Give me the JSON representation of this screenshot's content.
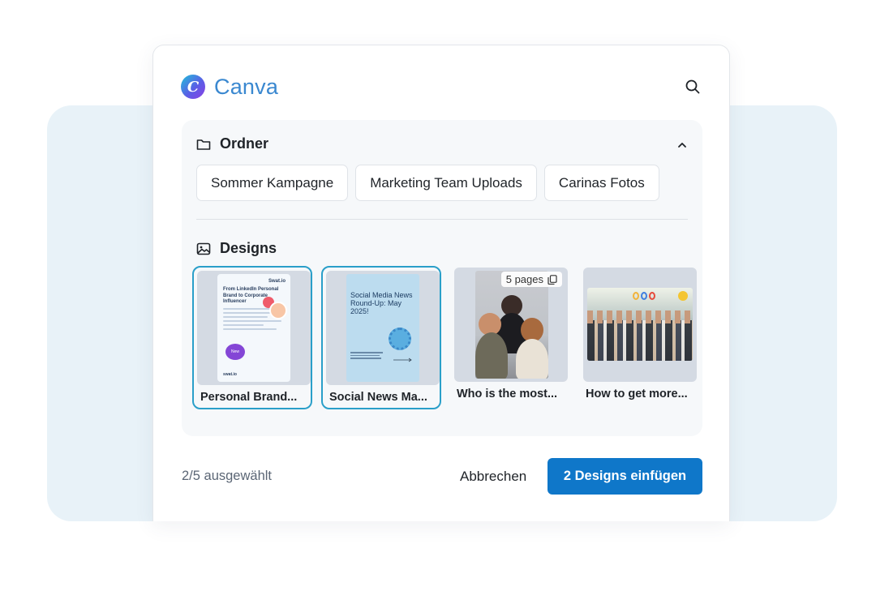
{
  "app": {
    "brand": "Canva",
    "logo_letter": "C"
  },
  "folders": {
    "title": "Ordner",
    "items": [
      {
        "label": "Sommer Kampagne"
      },
      {
        "label": "Marketing Team Uploads"
      },
      {
        "label": "Carinas Fotos"
      }
    ]
  },
  "designs": {
    "title": "Designs",
    "items": [
      {
        "label": "Personal Brand...",
        "selected": true,
        "thumb_text": {
          "logo": "Swat.io",
          "headline": "From LinkedIn Personal Brand to Corporate Influencer",
          "badge": "New",
          "footer": "swat.io"
        }
      },
      {
        "label": "Social News Ma...",
        "selected": true,
        "thumb_text": {
          "headline": "Social Media News Round-Up: May 2025!"
        }
      },
      {
        "label": "Who is the most...",
        "selected": false,
        "pages_badge": "5 pages"
      },
      {
        "label": "How to get more...",
        "selected": false
      }
    ]
  },
  "footer": {
    "status": "2/5 ausgewählt",
    "cancel_label": "Abbrechen",
    "primary_label": "2 Designs einfügen"
  },
  "colors": {
    "accent": "#0f77c9",
    "brand_text": "#3a88d0",
    "selected_border": "#2a9fc9",
    "backdrop": "#e8f2f8"
  },
  "icons": [
    "search-icon",
    "folder-icon",
    "chevron-up-icon",
    "image-icon",
    "copy-pages-icon"
  ]
}
